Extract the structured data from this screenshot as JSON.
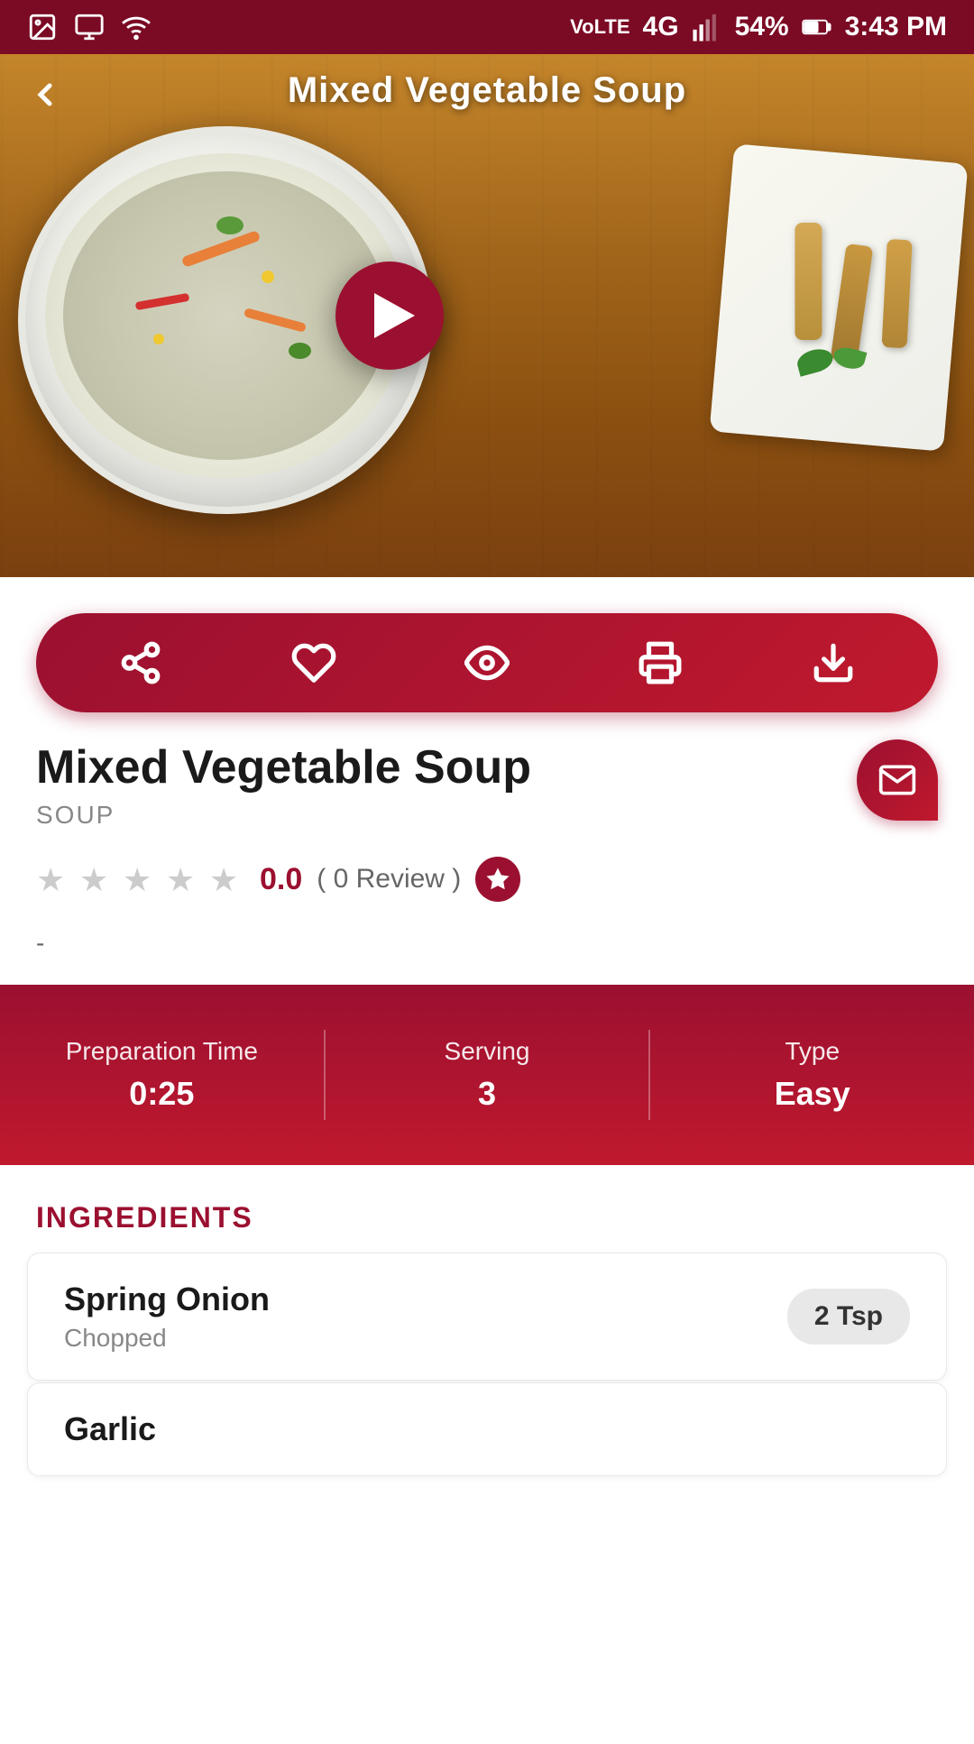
{
  "status": {
    "time": "3:43 PM",
    "battery": "54%",
    "network": "4G",
    "signal": "VoLTE"
  },
  "hero": {
    "title": "Mixed Vegetable Soup",
    "back_label": "‹"
  },
  "actions": {
    "share_icon": "share",
    "favorite_icon": "heart",
    "view_icon": "eye",
    "print_icon": "print",
    "download_icon": "download"
  },
  "recipe": {
    "name": "Mixed Vegetable Soup",
    "category": "SOUP",
    "rating": "0.0",
    "review_count": "( 0 Review )",
    "dash": "-"
  },
  "info": {
    "prep_label": "Preparation Time",
    "prep_value": "0:25",
    "serving_label": "Serving",
    "serving_value": "3",
    "type_label": "Type",
    "type_value": "Easy"
  },
  "ingredients": {
    "section_label": "INGREDIENTS",
    "items": [
      {
        "name": "Spring Onion",
        "detail": "Chopped",
        "qty": "2 Tsp"
      },
      {
        "name": "Garlic",
        "detail": "",
        "qty": ""
      }
    ]
  }
}
